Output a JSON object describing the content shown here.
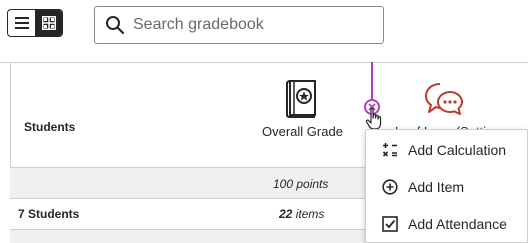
{
  "toolbar": {
    "view_toggle": {
      "list_icon": "list-view-icon",
      "grid_icon": "grid-view-icon",
      "active": "grid"
    },
    "search": {
      "icon": "search-icon",
      "placeholder": "Search gradebook",
      "value": ""
    }
  },
  "grid": {
    "students_header": "Students",
    "columns": [
      {
        "icon": "grade-book-icon",
        "label": "Overall Grade",
        "points": "100 points",
        "items": "22"
      },
      {
        "icon": "discussion-icon",
        "label": "Leaf  Logs (Setti",
        "points": "",
        "items": ""
      }
    ],
    "student_count_num": "7",
    "student_count_suffix": " Students",
    "items_suffix": " items"
  },
  "insert_marker": {
    "icon": "insert-column-icon"
  },
  "add_menu": {
    "items": [
      {
        "icon": "calculation-icon",
        "label": "Add Calculation"
      },
      {
        "icon": "add-circle-icon",
        "label": "Add Item"
      },
      {
        "icon": "attendance-checkbox-icon",
        "label": "Add Attendance"
      }
    ]
  },
  "colors": {
    "accent_insert": "#b43cc0",
    "discussion_icon": "#c0392b",
    "text": "#262626",
    "row_shade": "#f0f0f0"
  }
}
